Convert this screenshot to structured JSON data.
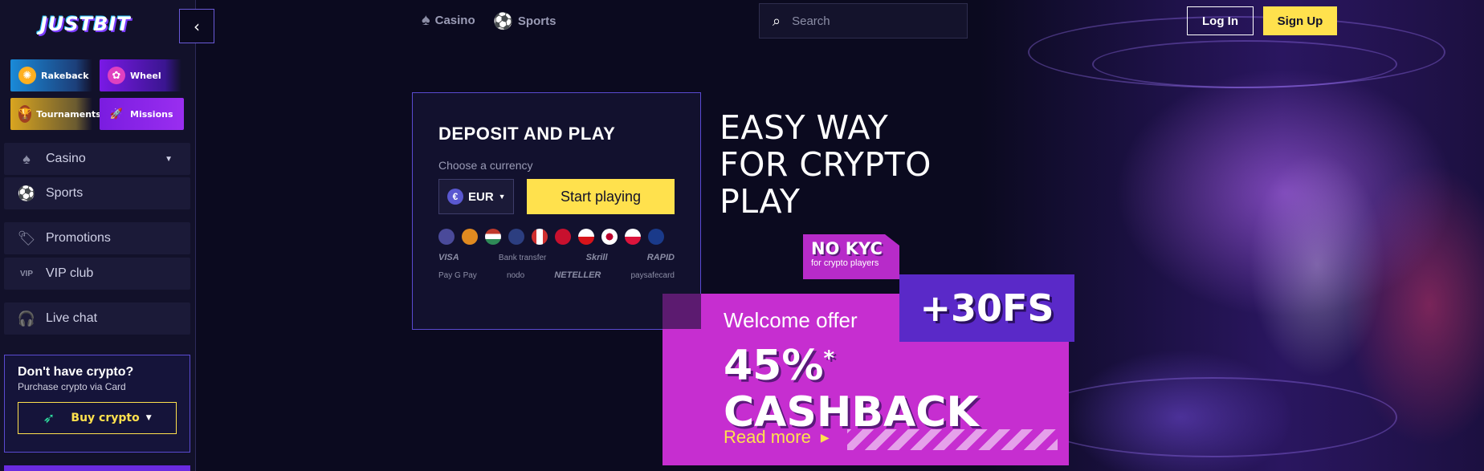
{
  "brand": {
    "logo_text": "JUSTBIT"
  },
  "sidebar": {
    "collapse_icon": "chevron-left-icon",
    "promo_tiles": [
      {
        "label": "Rakeback",
        "icon": "rakeback-icon"
      },
      {
        "label": "Wheel",
        "icon": "wheel-icon"
      },
      {
        "label": "Tournaments",
        "icon": "trophy-icon"
      },
      {
        "label": "Missions",
        "icon": "rocket-icon"
      }
    ],
    "nav": [
      {
        "label": "Casino",
        "icon": "spade-icon",
        "has_dropdown": true
      },
      {
        "label": "Sports",
        "icon": "soccer-ball-icon"
      },
      {
        "label": "Promotions",
        "icon": "tag-icon"
      },
      {
        "label": "VIP club",
        "icon": "vip-icon"
      },
      {
        "label": "Live chat",
        "icon": "headset-icon"
      }
    ],
    "crypto_box": {
      "title": "Don't have crypto?",
      "subtitle": "Purchase crypto via Card",
      "button_label": "Buy crypto"
    }
  },
  "topbar": {
    "casino_label": "Casino",
    "sports_label": "Sports",
    "search_placeholder": "Search",
    "login_label": "Log In",
    "signup_label": "Sign Up"
  },
  "deposit": {
    "title": "DEPOSIT AND PLAY",
    "subtitle": "Choose a currency",
    "currency_symbol": "€",
    "currency_value": "EUR",
    "start_label": "Start playing",
    "coin_colors": [
      "#4a4a9a",
      "#e08a20",
      "#c0392b",
      "#2c3e80",
      "#d03030",
      "#c8102e",
      "#3a5aa0",
      "#ffffff",
      "#c0c0c0",
      "#1a3a8a"
    ],
    "methods_row1": [
      "VISA",
      "Bank transfer",
      "Skrill",
      "RAPID"
    ],
    "methods_row2": [
      "Pay G Pay",
      "nodo",
      "NETELLER",
      "paysafecard"
    ]
  },
  "hero": {
    "headline_line1": "EASY WAY",
    "headline_line2": "FOR CRYPTO",
    "headline_line3": "PLAY",
    "nokyc_title": "NO KYC",
    "nokyc_sub": "for crypto players",
    "fs_badge": "+30FS",
    "welcome_label": "Welcome offer",
    "offer_percent": "45%",
    "offer_star": "*",
    "offer_word": "CASHBACK",
    "read_more": "Read more"
  }
}
